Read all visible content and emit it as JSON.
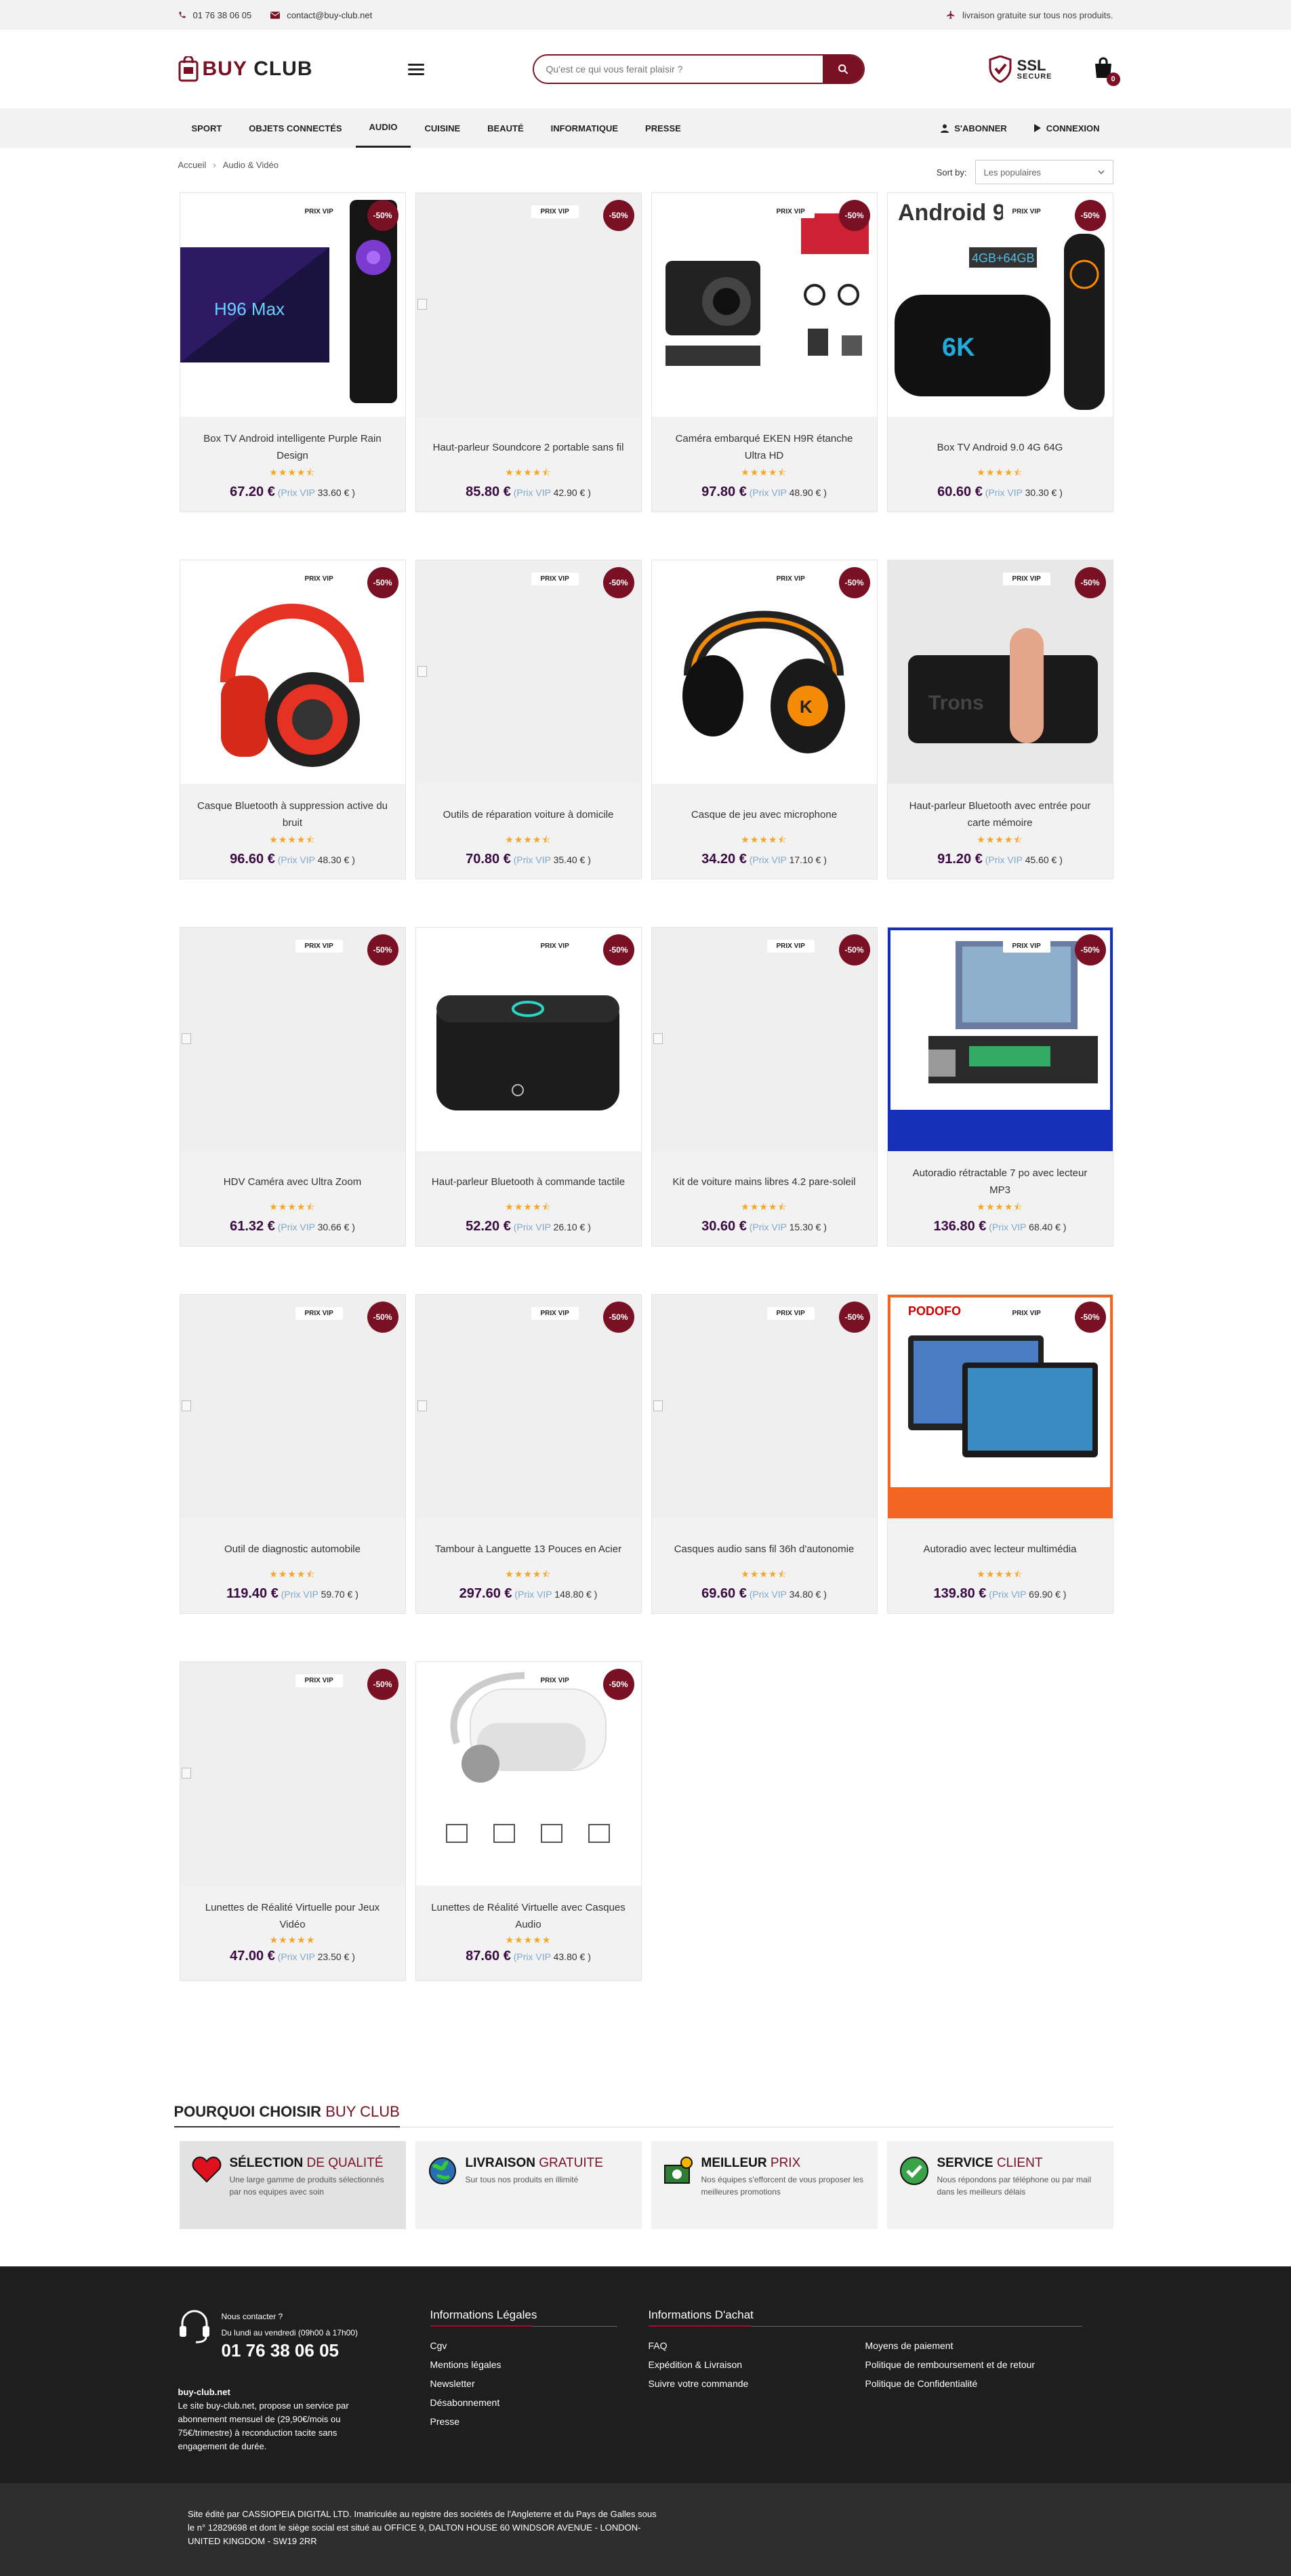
{
  "topbar": {
    "phone": "01 76 38 06 05",
    "email": "contact@buy-club.net",
    "shipping": "livraison gratuite sur tous nos produits."
  },
  "header": {
    "logo_text_1": "BUY",
    "logo_text_2": "CLUB",
    "search_placeholder": "Qu'est ce qui vous ferait plaisir ?",
    "ssl_big": "SSL",
    "ssl_small": "SECURE",
    "cart_count": "0"
  },
  "nav": {
    "items": [
      {
        "label": "SPORT",
        "active": false
      },
      {
        "label": "OBJETS CONNECTÉS",
        "active": false
      },
      {
        "label": "AUDIO",
        "active": true
      },
      {
        "label": "CUISINE",
        "active": false
      },
      {
        "label": "BEAUTÉ",
        "active": false
      },
      {
        "label": "INFORMATIQUE",
        "active": false
      },
      {
        "label": "PRESSE",
        "active": false
      }
    ],
    "subscribe": "S'ABONNER",
    "login": "CONNEXION"
  },
  "breadcrumb": {
    "home": "Accueil",
    "sep": "›",
    "current": "Audio & Vidéo"
  },
  "sort": {
    "label": "Sort by:",
    "value": "Les populaires"
  },
  "badges": {
    "vip": "PRIX VIP",
    "discount": "-50%",
    "vip_prefix": "(Prix VIP",
    "vip_suffix": ")"
  },
  "products": [
    {
      "name": "Box TV Android intelligente Purple Rain Design",
      "stars": "★★★★⯪",
      "price": "67.20 €",
      "vip": "33.60 €",
      "image": "tvbox-icon",
      "white": true
    },
    {
      "name": "Haut-parleur Soundcore 2 portable sans fil",
      "stars": "★★★★⯪",
      "price": "85.80 €",
      "vip": "42.90 €",
      "image": "broken-image-icon",
      "white": false
    },
    {
      "name": "Caméra embarqué EKEN H9R étanche Ultra HD",
      "stars": "★★★★⯪",
      "price": "97.80 €",
      "vip": "48.90 €",
      "image": "camera-icon",
      "white": true
    },
    {
      "name": "Box TV Android 9.0 4G 64G",
      "stars": "★★★★⯪",
      "price": "60.60 €",
      "vip": "30.30 €",
      "image": "tvbox2-icon",
      "white": true
    },
    {
      "name": "Casque Bluetooth à suppression active du bruit",
      "stars": "★★★★⯪",
      "price": "96.60 €",
      "vip": "48.30 €",
      "image": "headphones-icon",
      "white": true
    },
    {
      "name": "Outils de réparation voiture à domicile",
      "stars": "★★★★⯪",
      "price": "70.80 €",
      "vip": "35.40 €",
      "image": "broken-image-icon",
      "white": false
    },
    {
      "name": "Casque de jeu avec microphone",
      "stars": "★★★★⯪",
      "price": "34.20 €",
      "vip": "17.10 €",
      "image": "gaming-headset-icon",
      "white": true
    },
    {
      "name": "Haut-parleur Bluetooth avec entrée pour carte mémoire",
      "stars": "★★★★⯪",
      "price": "91.20 €",
      "vip": "45.60 €",
      "image": "speaker-icon",
      "white": true
    },
    {
      "name": "HDV Caméra avec Ultra Zoom",
      "stars": "★★★★⯪",
      "price": "61.32 €",
      "vip": "30.66 €",
      "image": "broken-image-icon",
      "white": false
    },
    {
      "name": "Haut-parleur Bluetooth à commande tactile",
      "stars": "★★★★⯪",
      "price": "52.20 €",
      "vip": "26.10 €",
      "image": "speaker2-icon",
      "white": true
    },
    {
      "name": "Kit de voiture mains libres 4.2 pare-soleil",
      "stars": "★★★★⯪",
      "price": "30.60 €",
      "vip": "15.30 €",
      "image": "broken-image-icon",
      "white": false
    },
    {
      "name": "Autoradio rétractable 7 po avec lecteur MP3",
      "stars": "★★★★⯪",
      "price": "136.80 €",
      "vip": "68.40 €",
      "image": "autoradio-icon",
      "white": true
    },
    {
      "name": "Outil de diagnostic automobile",
      "stars": "★★★★⯪",
      "price": "119.40 €",
      "vip": "59.70 €",
      "image": "broken-image-icon",
      "white": false
    },
    {
      "name": "Tambour à Languette 13 Pouces en Acier",
      "stars": "★★★★⯪",
      "price": "297.60 €",
      "vip": "148.80 €",
      "image": "broken-image-icon",
      "white": false
    },
    {
      "name": "Casques audio sans fil 36h d'autonomie",
      "stars": "★★★★⯪",
      "price": "69.60 €",
      "vip": "34.80 €",
      "image": "broken-image-icon",
      "white": false
    },
    {
      "name": "Autoradio avec lecteur multimédia",
      "stars": "★★★★⯪",
      "price": "139.80 €",
      "vip": "69.90 €",
      "image": "multimedia-radio-icon",
      "white": true
    },
    {
      "name": "Lunettes de Réalité Virtuelle pour Jeux Vidéo",
      "stars": "★★★★★",
      "price": "47.00 €",
      "vip": "23.50 €",
      "image": "broken-image-icon",
      "white": false
    },
    {
      "name": "Lunettes de Réalité Virtuelle avec Casques Audio",
      "stars": "★★★★★",
      "price": "87.60 €",
      "vip": "43.80 €",
      "image": "vr-headset-icon",
      "white": true
    }
  ],
  "why": {
    "title_1": "POURQUOI CHOISIR",
    "title_2": "BUY CLUB",
    "boxes": [
      {
        "t1": "SÉLECTION",
        "t2": "DE QUALITÉ",
        "text": "Une large gamme de produits sélectionnés par nos equipes avec soin",
        "icon": "heart-icon"
      },
      {
        "t1": "LIVRAISON",
        "t2": "GRATUITE",
        "text": "Sur tous nos produits en illimité",
        "icon": "globe-icon"
      },
      {
        "t1": "MEILLEUR",
        "t2": "PRIX",
        "text": "Nos équipes s'efforcent de vous proposer les meilleures promotions",
        "icon": "money-icon"
      },
      {
        "t1": "SERVICE",
        "t2": "CLIENT",
        "text": "Nous répondons par téléphone ou par mail dans les meilleurs délais",
        "icon": "check-icon"
      }
    ]
  },
  "footer": {
    "contact_label": "Nous contacter ?",
    "hours": "Du lundi au vendredi (09h00 à 17h00)",
    "phone": "01 76 38 06 05",
    "about_title": "buy-club.net",
    "about_text": "Le site buy-club.net, propose un service par abonnement mensuel de (29,90€/mois ou 75€/trimestre) à reconduction tacite sans engagement de durée.",
    "legal_title": "Informations Légales",
    "legal_links": [
      "Cgv",
      "Mentions légales",
      "Newsletter",
      "Désabonnement",
      "Presse"
    ],
    "purchase_title": "Informations D'achat",
    "purchase_links_1": [
      "FAQ",
      "Expédition & Livraison",
      "Suivre votre commande"
    ],
    "purchase_links_2": [
      "Moyens de paiement",
      "Politique de remboursement et de retour",
      "Politique de Confidentialité"
    ],
    "bottom_text": "Site édité par CASSIOPEIA DIGITAL LTD. Imatriculée au registre des sociétés de l'Angleterre et du Pays de Galles sous le n° 12829698 et dont le siège social est situé au OFFICE 9, DALTON HOUSE 60 WINDSOR AVENUE - LONDON- UNITED KINGDOM - SW19 2RR"
  }
}
